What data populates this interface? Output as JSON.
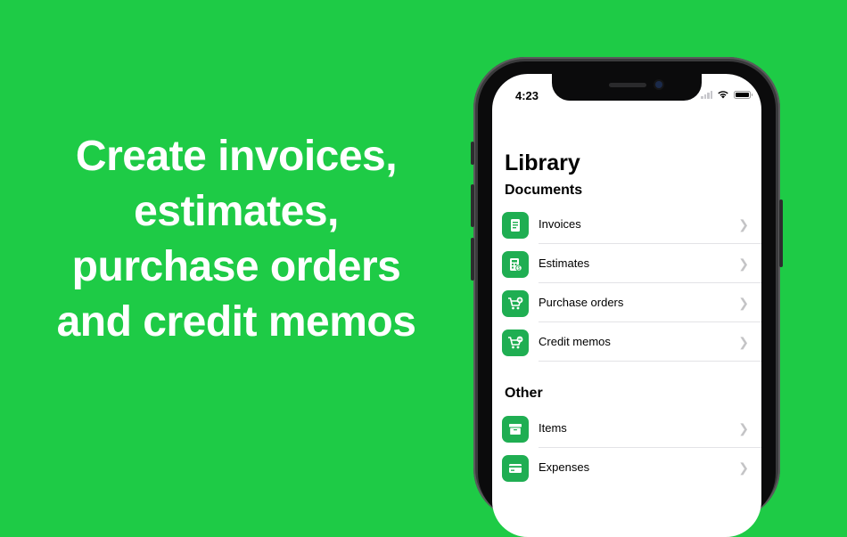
{
  "headline": {
    "lines": [
      "Create invoices,",
      "estimates,",
      "purchase orders",
      "and credit memos"
    ]
  },
  "status_bar": {
    "time": "4:23"
  },
  "library": {
    "title": "Library",
    "sections": [
      {
        "title": "Documents",
        "items": [
          {
            "label": "Invoices",
            "icon": "invoice-doc-icon"
          },
          {
            "label": "Estimates",
            "icon": "estimate-calculator-icon"
          },
          {
            "label": "Purchase orders",
            "icon": "cart-plus-icon"
          },
          {
            "label": "Credit memos",
            "icon": "cart-minus-icon"
          }
        ]
      },
      {
        "title": "Other",
        "items": [
          {
            "label": "Items",
            "icon": "box-icon"
          },
          {
            "label": "Expenses",
            "icon": "credit-card-icon"
          }
        ]
      }
    ]
  },
  "colors": {
    "background": "#1ecb46",
    "accent": "#1fae52"
  }
}
